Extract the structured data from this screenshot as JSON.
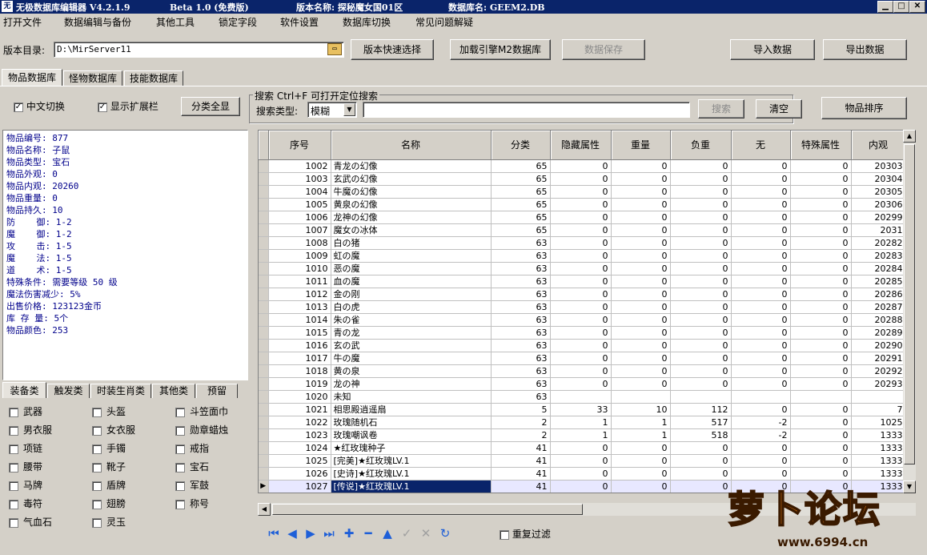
{
  "titlebar": {
    "app_title": "无极数据库编辑器 V4.2.1.9",
    "edition": "Beta 1.0 (免费版)",
    "version_name": "版本名称: 探秘魔女国01区",
    "db_name": "数据库名: GEEM2.DB",
    "minimize": "▁",
    "maximize": "□",
    "close": "✕"
  },
  "menu": [
    "打开文件",
    "数据编辑与备份",
    "其他工具",
    "锁定字段",
    "软件设置",
    "数据库切换",
    "常见问题解疑"
  ],
  "toolbar": {
    "dir_label": "版本目录:",
    "dir_value": "D:\\MirServer11",
    "quick_select": "版本快速选择",
    "load_engine": "加载引擎M2数据库",
    "save_data": "数据保存",
    "import_data": "导入数据",
    "export_data": "导出数据"
  },
  "tabs": [
    "物品数据库",
    "怪物数据库",
    "技能数据库"
  ],
  "options": {
    "chinese_switch": "中文切换",
    "show_extension": "显示扩展栏",
    "show_all_categories": "分类全显"
  },
  "search": {
    "group_title": "搜索  Ctrl+F 可打开定位搜索",
    "type_label": "搜索类型:",
    "type_value": "模糊",
    "search_button": "搜索",
    "clear_button": "清空",
    "sort_button": "物品排序"
  },
  "item_info": [
    "物品编号: 877",
    "物品名称: 子鼠",
    "物品类型: 宝石",
    "物品外观: 0",
    "物品内观: 20260",
    "物品重量: 0",
    "物品持久: 10",
    "防    御: 1-2",
    "魔    御: 1-2",
    "攻    击: 1-5",
    "魔    法: 1-5",
    "道    术: 1-5",
    "特殊条件: 需要等级 50 级",
    "魔法伤害减少: 5%",
    "出售价格: 123123金币",
    "库 存 量: 5个",
    "物品颜色: 253"
  ],
  "category_tabs": [
    "装备类",
    "触发类",
    "时装生肖类",
    "其他类",
    "预留"
  ],
  "categories": [
    [
      "武器",
      "头盔",
      "斗笠面巾"
    ],
    [
      "男衣服",
      "女衣服",
      "勋章蜡烛"
    ],
    [
      "项链",
      "手镯",
      "戒指"
    ],
    [
      "腰带",
      "靴子",
      "宝石"
    ],
    [
      "马牌",
      "盾牌",
      "军鼓"
    ],
    [
      "毒符",
      "翅膀",
      "称号"
    ],
    [
      "气血石",
      "灵玉"
    ]
  ],
  "table": {
    "columns": [
      "序号",
      "名称",
      "分类",
      "隐藏属性",
      "重量",
      "负重",
      "无",
      "特殊属性",
      "内观"
    ],
    "rows": [
      [
        "1002",
        "青龙の幻像",
        "65",
        "0",
        "0",
        "0",
        "0",
        "0",
        "20303"
      ],
      [
        "1003",
        "玄武の幻像",
        "65",
        "0",
        "0",
        "0",
        "0",
        "0",
        "20304"
      ],
      [
        "1004",
        "牛魔の幻像",
        "65",
        "0",
        "0",
        "0",
        "0",
        "0",
        "20305"
      ],
      [
        "1005",
        "黄泉の幻像",
        "65",
        "0",
        "0",
        "0",
        "0",
        "0",
        "20306"
      ],
      [
        "1006",
        "龙神の幻像",
        "65",
        "0",
        "0",
        "0",
        "0",
        "0",
        "20299"
      ],
      [
        "1007",
        "魔女の冰体",
        "65",
        "0",
        "0",
        "0",
        "0",
        "0",
        "2031"
      ],
      [
        "1008",
        "白の猪",
        "63",
        "0",
        "0",
        "0",
        "0",
        "0",
        "20282"
      ],
      [
        "1009",
        "虹の魔",
        "63",
        "0",
        "0",
        "0",
        "0",
        "0",
        "20283"
      ],
      [
        "1010",
        "恶の魔",
        "63",
        "0",
        "0",
        "0",
        "0",
        "0",
        "20284"
      ],
      [
        "1011",
        "血の魔",
        "63",
        "0",
        "0",
        "0",
        "0",
        "0",
        "20285"
      ],
      [
        "1012",
        "金の刚",
        "63",
        "0",
        "0",
        "0",
        "0",
        "0",
        "20286"
      ],
      [
        "1013",
        "白の虎",
        "63",
        "0",
        "0",
        "0",
        "0",
        "0",
        "20287"
      ],
      [
        "1014",
        "朱の雀",
        "63",
        "0",
        "0",
        "0",
        "0",
        "0",
        "20288"
      ],
      [
        "1015",
        "青の龙",
        "63",
        "0",
        "0",
        "0",
        "0",
        "0",
        "20289"
      ],
      [
        "1016",
        "玄の武",
        "63",
        "0",
        "0",
        "0",
        "0",
        "0",
        "20290"
      ],
      [
        "1017",
        "牛の魔",
        "63",
        "0",
        "0",
        "0",
        "0",
        "0",
        "20291"
      ],
      [
        "1018",
        "黄の泉",
        "63",
        "0",
        "0",
        "0",
        "0",
        "0",
        "20292"
      ],
      [
        "1019",
        "龙の神",
        "63",
        "0",
        "0",
        "0",
        "0",
        "0",
        "20293"
      ],
      [
        "1020",
        "未知",
        "63",
        "",
        "",
        "",
        "",
        "",
        ""
      ],
      [
        "1021",
        "相思殿逍遥扇",
        "5",
        "33",
        "10",
        "112",
        "0",
        "0",
        "7"
      ],
      [
        "1022",
        "玫瑰随机石",
        "2",
        "1",
        "1",
        "517",
        "-2",
        "0",
        "1025"
      ],
      [
        "1023",
        "玫瑰嘲讽卷",
        "2",
        "1",
        "1",
        "518",
        "-2",
        "0",
        "1333"
      ],
      [
        "1024",
        "★红玫瑰种子",
        "41",
        "0",
        "0",
        "0",
        "0",
        "0",
        "1333"
      ],
      [
        "1025",
        "[完美]★红玫瑰LV.1",
        "41",
        "0",
        "0",
        "0",
        "0",
        "0",
        "1333"
      ],
      [
        "1026",
        "[史诗]★红玫瑰LV.1",
        "41",
        "0",
        "0",
        "0",
        "0",
        "0",
        "1333"
      ],
      [
        "1027",
        "[传说]★红玫瑰LV.1",
        "41",
        "0",
        "0",
        "0",
        "0",
        "0",
        "1333"
      ]
    ],
    "selected_row": 25
  },
  "nav": {
    "repeat_filter": "重复过滤",
    "buttons": [
      "first-icon",
      "prior-icon",
      "next-icon",
      "last-icon",
      "insert-icon",
      "delete-icon",
      "edit-icon",
      "post-icon",
      "cancel-icon",
      "refresh-icon"
    ]
  },
  "watermark": {
    "logo_text": "萝卜论坛",
    "site": "www.6994.cn"
  }
}
